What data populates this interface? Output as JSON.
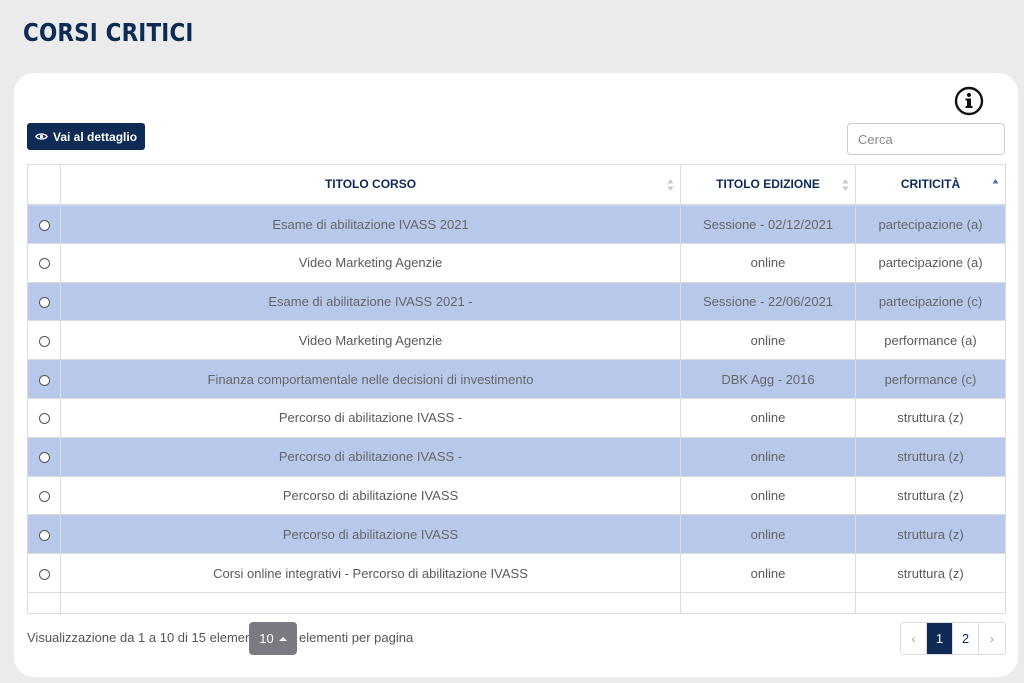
{
  "page": {
    "title": "CORSI CRITICI"
  },
  "toolbar": {
    "detail_label": "Vai al dettaglio",
    "search_placeholder": "Cerca"
  },
  "table": {
    "headers": {
      "course": "TITOLO CORSO",
      "edition": "TITOLO EDIZIONE",
      "criticality": "CRITICITÀ"
    },
    "rows": [
      {
        "course": "Esame di abilitazione IVASS 2021",
        "edition": "Sessione - 02/12/2021",
        "criticality": "partecipazione (a)",
        "align": "center",
        "shaded": true
      },
      {
        "course": "Video Marketing Agenzie",
        "edition": "online",
        "criticality": "partecipazione (a)",
        "align": "center",
        "shaded": false
      },
      {
        "course": "Esame di abilitazione IVASS 2021 -",
        "edition": "Sessione - 22/06/2021",
        "criticality": "partecipazione (c)",
        "align": "center",
        "shaded": true
      },
      {
        "course": "Video Marketing Agenzie",
        "edition": "online",
        "criticality": "performance (a)",
        "align": "center",
        "shaded": false
      },
      {
        "course": "Finanza comportamentale nelle decisioni di investimento",
        "edition": "DBK Agg - 2016",
        "criticality": "performance (c)",
        "align": "center",
        "shaded": true
      },
      {
        "course": "Percorso di abilitazione IVASS -",
        "edition": "online",
        "criticality": "struttura (z)",
        "align": "center",
        "shaded": false
      },
      {
        "course": "Percorso di abilitazione IVASS -",
        "edition": "online",
        "criticality": "struttura (z)",
        "align": "center",
        "shaded": true
      },
      {
        "course": "Percorso di abilitazione IVASS",
        "edition": "online",
        "criticality": "struttura (z)",
        "align": "center",
        "shaded": false
      },
      {
        "course": "Percorso di abilitazione IVASS",
        "edition": "online",
        "criticality": "struttura (z)",
        "align": "center",
        "shaded": true
      },
      {
        "course": "Corsi online integrativi - Percorso di abilitazione IVASS",
        "edition": "online",
        "criticality": "struttura (z)",
        "align": "center",
        "shaded": false
      }
    ]
  },
  "footer": {
    "info": "Visualizzazione da 1 a 10 di 15 elementi",
    "page_size": "10",
    "per_page_label": "elementi per pagina"
  },
  "pagination": {
    "prev": "‹",
    "pages": [
      "1",
      "2"
    ],
    "active": "1",
    "next": "›"
  },
  "colors": {
    "brand": "#0d2b55",
    "row_highlight": "#b8c8eb",
    "background": "#ebebeb"
  },
  "icons": {
    "info": "info-circle-icon",
    "eye": "eye-icon",
    "sort": "sort-icon"
  }
}
